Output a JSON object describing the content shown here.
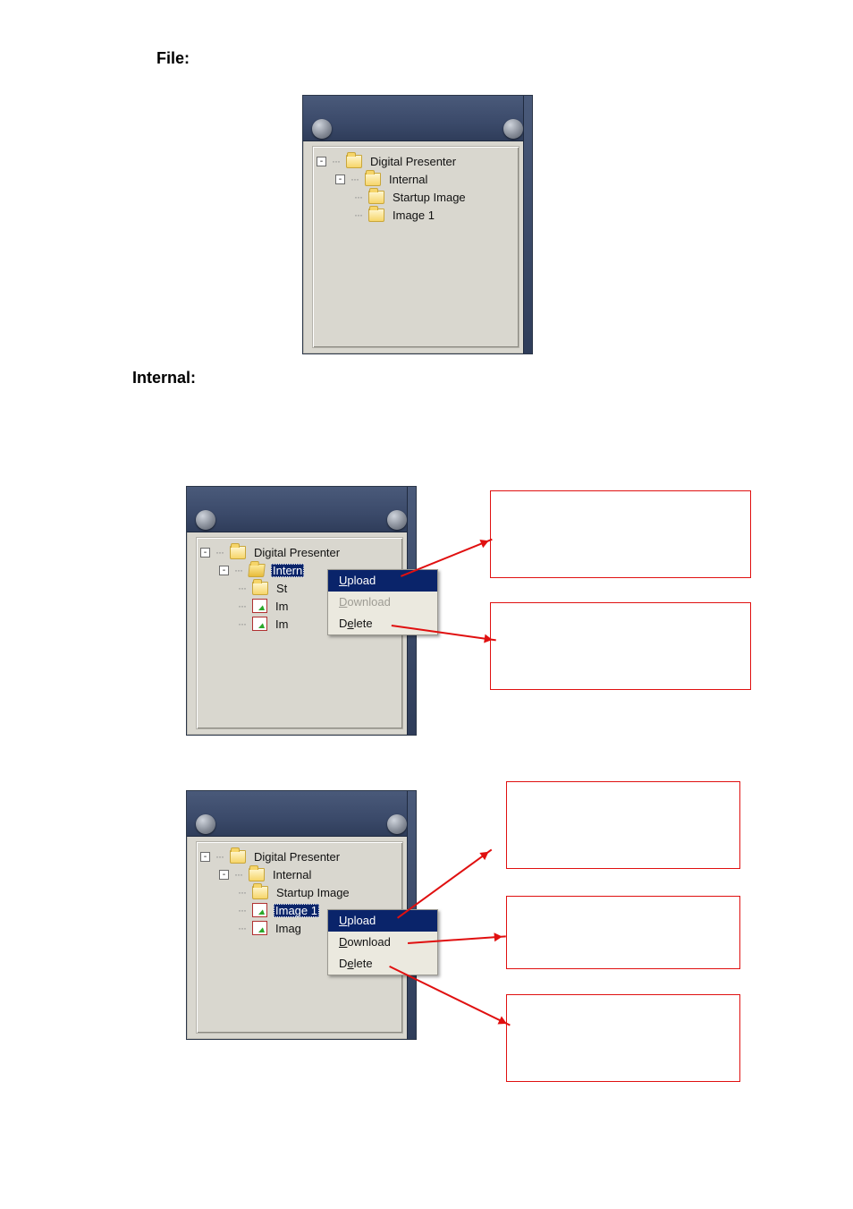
{
  "headings": {
    "file": "File:",
    "internal": "Internal:"
  },
  "tree": {
    "root": "Digital Presenter",
    "internal": "Internal",
    "startup_image": "Startup Image",
    "image1": "Image 1",
    "startup_abbrev": "St",
    "image_abbrev1": "Im",
    "image_abbrev2": "Im",
    "internal_sel": "Intern",
    "image1_sel": "Image 1",
    "image_trunc": "Imag"
  },
  "menu": {
    "upload_u": "U",
    "upload_rest": "pload",
    "download_d": "D",
    "download_rest": "ownload",
    "delete_d_pre": "D",
    "delete_e": "e",
    "delete_rest": "lete"
  }
}
